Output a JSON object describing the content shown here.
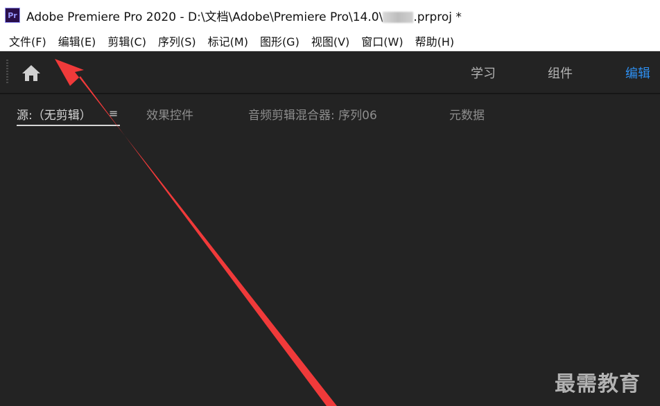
{
  "window": {
    "app_icon_text": "Pr",
    "title_prefix": "Adobe Premiere Pro 2020 - D:\\文档\\Adobe\\Premiere Pro\\14.0\\",
    "title_suffix": ".prproj *"
  },
  "menubar": {
    "items": [
      {
        "label": "文件(F)"
      },
      {
        "label": "编辑(E)"
      },
      {
        "label": "剪辑(C)"
      },
      {
        "label": "序列(S)"
      },
      {
        "label": "标记(M)"
      },
      {
        "label": "图形(G)"
      },
      {
        "label": "视图(V)"
      },
      {
        "label": "窗口(W)"
      },
      {
        "label": "帮助(H)"
      }
    ]
  },
  "workspace": {
    "home_icon": "home-icon",
    "tabs": [
      {
        "label": "学习",
        "active": false
      },
      {
        "label": "组件",
        "active": false
      },
      {
        "label": "编辑",
        "active": true
      }
    ],
    "active_color": "#2e8ff0"
  },
  "panel": {
    "tabs": [
      {
        "label": "源:（无剪辑）",
        "active": true
      },
      {
        "label": "效果控件",
        "active": false
      },
      {
        "label": "音频剪辑混合器: 序列06",
        "active": false
      },
      {
        "label": "元数据",
        "active": false
      }
    ],
    "menu_icon": "hamburger-menu-icon"
  },
  "annotation": {
    "type": "red-arrow",
    "points_to": "file-menu",
    "color": "#f03a3a"
  },
  "watermark": {
    "text": "最需教育"
  }
}
